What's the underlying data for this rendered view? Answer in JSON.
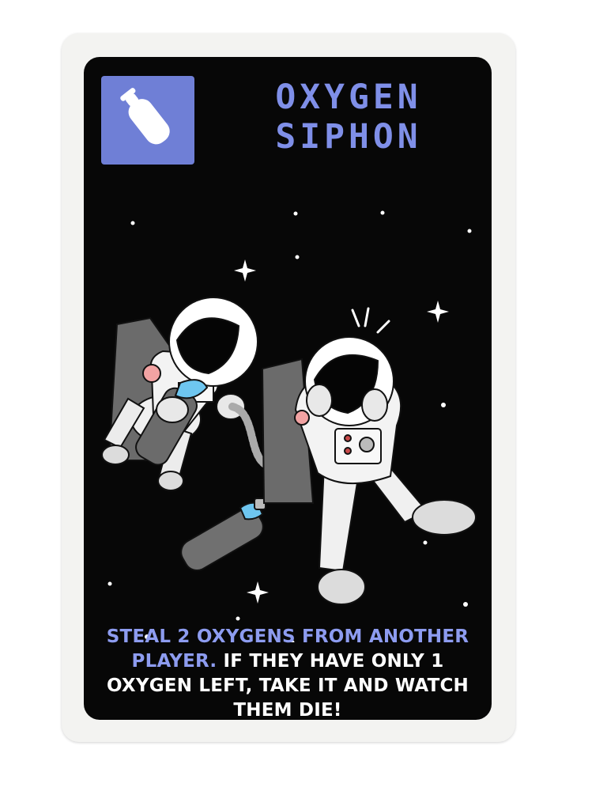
{
  "card": {
    "title_line1": "OXYGEN",
    "title_line2": "SIPHON",
    "type_icon": "oxygen-tank-icon",
    "effect_highlight": "STEAL 2 OXYGENS FROM ANOTHER PLAYER.",
    "effect_rest": "IF THEY HAVE ONLY 1 OXYGEN LEFT, TAKE IT AND WATCH THEM DIE!",
    "colors": {
      "accent": "#7f8fe8",
      "icon_background": "#6f7fd6",
      "card_background": "#070707",
      "border": "#f3f3f1",
      "tank_glass": "#6ec6f0"
    }
  }
}
